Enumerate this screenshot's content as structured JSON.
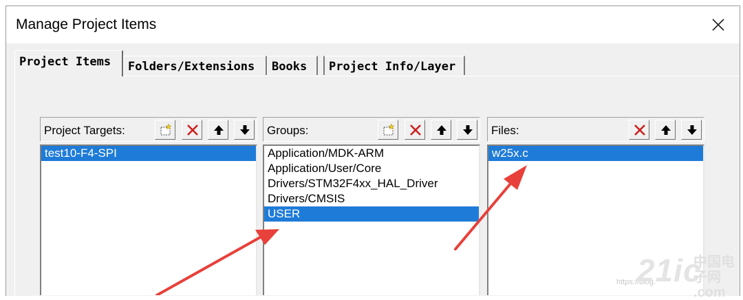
{
  "window": {
    "title": "Manage Project Items"
  },
  "tabs": [
    {
      "label": "Project Items",
      "active": true
    },
    {
      "label": "Folders/Extensions",
      "active": false
    },
    {
      "label": "Books",
      "active": false
    },
    {
      "label": "Project Info/Layer",
      "active": false
    }
  ],
  "targets": {
    "label": "Project Targets:",
    "items": [
      {
        "text": "test10-F4-SPI",
        "selected": true
      }
    ],
    "buttons": [
      "new-icon",
      "delete-icon",
      "move-up-icon",
      "move-down-icon"
    ]
  },
  "groups": {
    "label": "Groups:",
    "items": [
      {
        "text": "Application/MDK-ARM",
        "selected": false
      },
      {
        "text": "Application/User/Core",
        "selected": false
      },
      {
        "text": "Drivers/STM32F4xx_HAL_Driver",
        "selected": false
      },
      {
        "text": "Drivers/CMSIS",
        "selected": false
      },
      {
        "text": "USER",
        "selected": true
      }
    ],
    "buttons": [
      "new-icon",
      "delete-icon",
      "move-up-icon",
      "move-down-icon"
    ]
  },
  "files": {
    "label": "Files:",
    "items": [
      {
        "text": "w25x.c",
        "selected": true
      }
    ],
    "buttons": [
      "delete-icon",
      "move-up-icon",
      "move-down-icon"
    ]
  },
  "colors": {
    "selection": "#1e7bd8",
    "arrow": "#e8403a",
    "delete": "#cc1f1f"
  },
  "watermark": {
    "url": "https://blog.",
    "brand": "21ic",
    "brand_cn": "中国电子网",
    "domain": ".com"
  }
}
